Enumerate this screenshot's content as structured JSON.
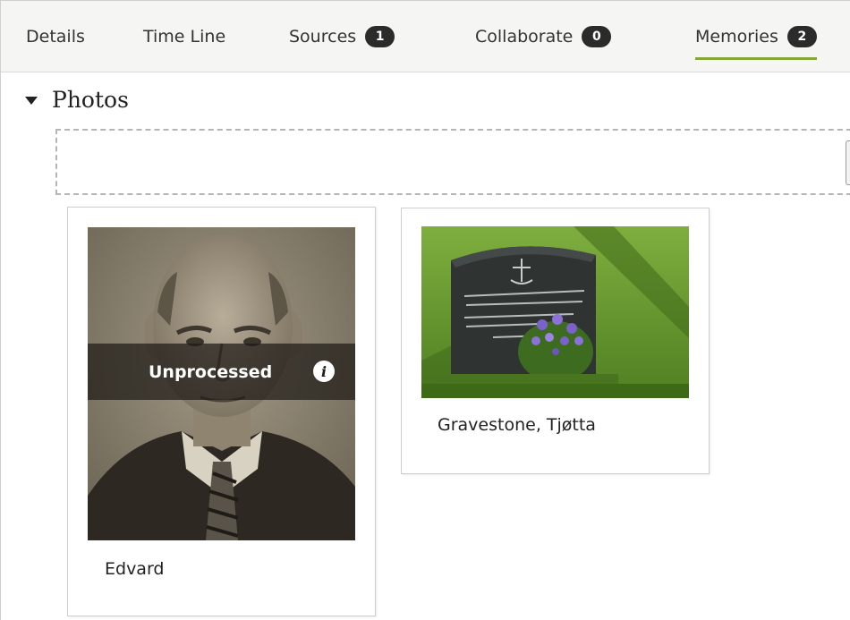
{
  "tabs": [
    {
      "label": "Details"
    },
    {
      "label": "Time Line"
    },
    {
      "label": "Sources",
      "count": "1"
    },
    {
      "label": "Collaborate",
      "count": "0"
    },
    {
      "label": "Memories",
      "count": "2",
      "active": true
    }
  ],
  "colors": {
    "active_tab_underline": "#86a636",
    "badge_background": "#2b2b2b"
  },
  "photos_section": {
    "title": "Photos",
    "items": [
      {
        "caption": "Edvard",
        "status": "Unprocessed",
        "status_icon": "info-icon"
      },
      {
        "caption": "Gravestone, Tjøtta"
      }
    ]
  }
}
